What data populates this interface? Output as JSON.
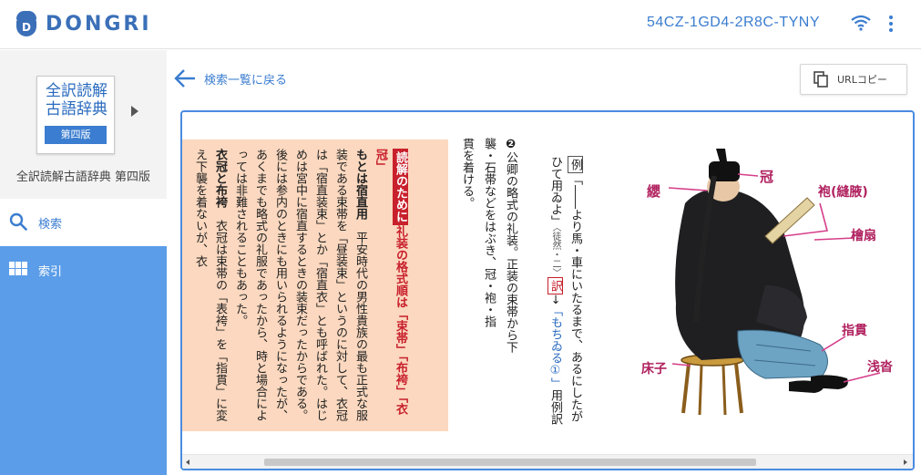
{
  "header": {
    "logo_letter": "D",
    "logo_text": "DONGRI",
    "device_id": "54CZ-1GD4-2R8C-TYNY",
    "wifi_icon": "wifi-icon",
    "menu_icon": "kebab-menu-icon",
    "accent": "#3b7dd0"
  },
  "sidebar": {
    "book": {
      "cover_title_line1": "全訳読解",
      "cover_title_line2": "古語辞典",
      "cover_edition": "第四版",
      "name": "全訳読解古語辞典 第四版"
    },
    "items": [
      {
        "label": "検索",
        "icon": "search-icon",
        "active": true
      },
      {
        "label": "索引",
        "icon": "grid-icon",
        "active": false
      }
    ],
    "color": "#5b9de8"
  },
  "toolbar": {
    "back_label": "検索一覧に戻る",
    "url_copy_label": "URLコピー"
  },
  "note": {
    "tag": "読解のために",
    "heading": "礼装の格式順は「束帯」「布袴」「衣冠」",
    "p1_bold": "もとは宿直用",
    "p1": "平安時代の男性貴族の最も正式な服装である束帯を「昼装束」というのに対して、衣冠は「宿直装束」とか「宿直衣」とも呼ばれた。はじめは宮中に宿直するときの装束だったからである。後には参内のときにも用いられるようになったが、あくまでも略式の礼服であったから、時と場合によっては非難されることもあった。",
    "p2_bold": "衣冠と布袴",
    "p2": "衣冠は束帯の「表袴」を「指貫」に変え下襲を着ないが、衣"
  },
  "entry": {
    "marker": "❷",
    "line1": "公卿の略式の礼装。正装の束帯から下",
    "line2": "襲・石帯などをはぶき、冠・袍・指",
    "line3": "貫を着ける。"
  },
  "example": {
    "ex_label": "例",
    "ex_text": "「――より馬・車にいたるまで、あるにしたがひて用ゐよ」",
    "source": "〈徒然・二〉",
    "tr_label": "訳",
    "tr_arrow": "→",
    "tr_link": "「もちゐる①」",
    "tr_suffix": "用例訳"
  },
  "illustration": {
    "labels": {
      "kanmuri": "冠",
      "ei": "纓",
      "hou": "袍(縫腋)",
      "hiougi": "檜扇",
      "sashinuki": "指貫",
      "shouji": "床子",
      "asagutsu": "浅沓"
    }
  }
}
